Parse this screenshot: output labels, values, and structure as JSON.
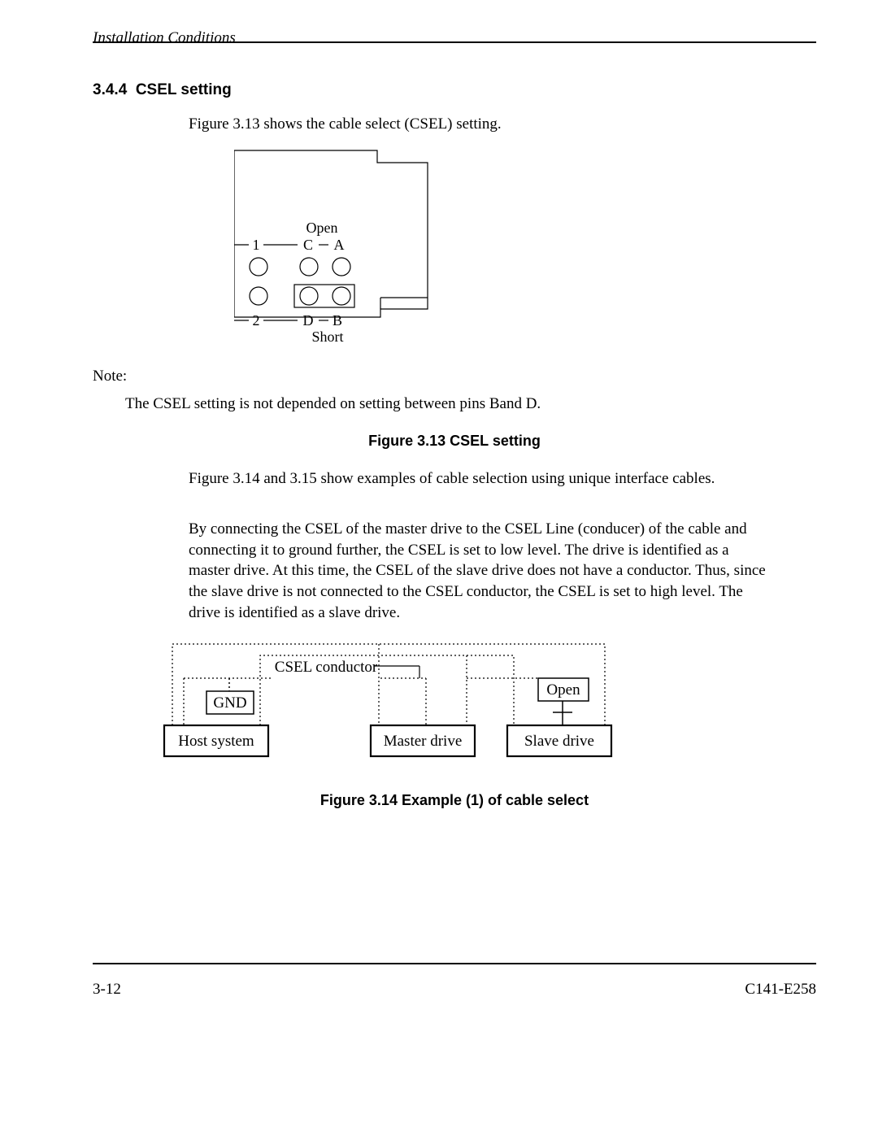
{
  "header": {
    "title": "Installation Conditions"
  },
  "section": {
    "number": "3.4.4",
    "title": "CSEL setting"
  },
  "intro": "Figure 3.13 shows the cable select (CSEL) setting.",
  "fig313": {
    "labels": {
      "open": "Open",
      "one": "1",
      "two": "2",
      "A": "A",
      "B": "B",
      "C": "C",
      "D": "D",
      "short": "Short"
    }
  },
  "note": {
    "label": "Note:",
    "body": "The CSEL setting is not depended on setting between pins Band D."
  },
  "fig313_caption": "Figure 3.13  CSEL setting",
  "mid1": "Figure 3.14 and 3.15 show examples of cable selection using unique interface cables.",
  "mid2": "By connecting the CSEL of the master drive to the CSEL Line (conducer) of the cable and connecting it to ground further, the CSEL is set to low level.  The drive is identified as a master drive.  At this time, the CSEL of the slave drive does not have a conductor.  Thus, since the slave drive is not connected to the CSEL conductor, the CSEL is set to high level.  The drive is identified as a slave drive.",
  "fig314": {
    "csel": "CSEL conductor",
    "gnd": "GND",
    "open": "Open",
    "host": "Host system",
    "master": "Master drive",
    "slave": "Slave drive"
  },
  "fig314_caption": "Figure 3.14  Example (1) of cable select",
  "footer": {
    "page": "3-12",
    "doc": "C141-E258"
  }
}
